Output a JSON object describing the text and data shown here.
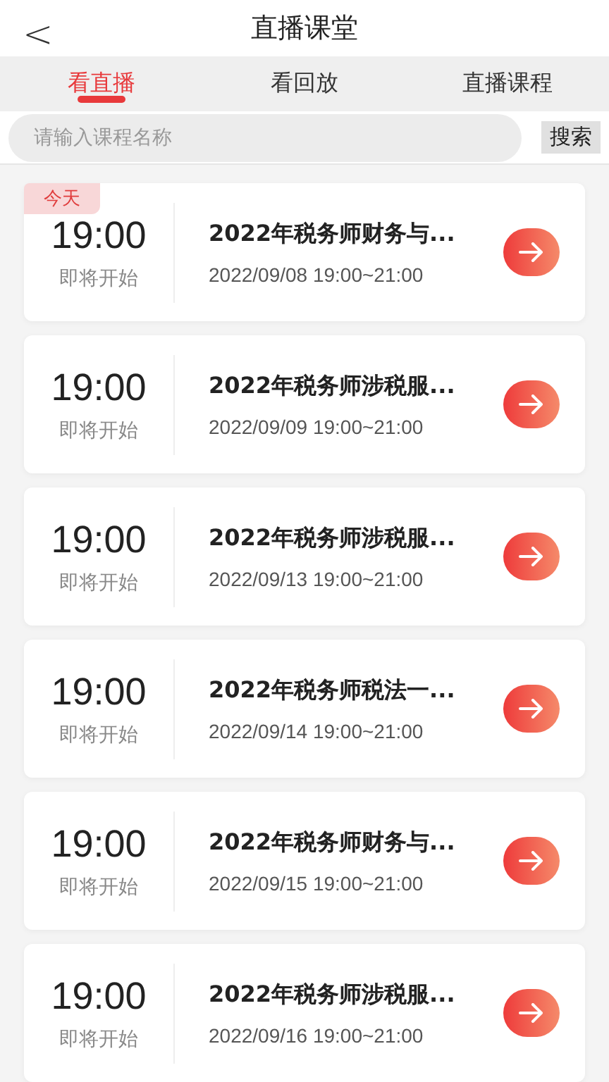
{
  "header": {
    "back": "<",
    "title": "直播课堂"
  },
  "tabs": [
    {
      "label": "看直播",
      "selected": true
    },
    {
      "label": "看回放",
      "selected": false
    },
    {
      "label": "直播课程",
      "selected": false
    }
  ],
  "search": {
    "placeholder": "请输入课程名称",
    "button": "搜索"
  },
  "lessons": [
    {
      "tag": "今天",
      "time": "19:00",
      "status": "即将开始",
      "title": "2022年税务师财务与...",
      "date": "2022/09/08 19:00~21:00"
    },
    {
      "time": "19:00",
      "status": "即将开始",
      "title": "2022年税务师涉税服...",
      "date": "2022/09/09 19:00~21:00"
    },
    {
      "time": "19:00",
      "status": "即将开始",
      "title": "2022年税务师涉税服...",
      "date": "2022/09/13 19:00~21:00"
    },
    {
      "time": "19:00",
      "status": "即将开始",
      "title": "2022年税务师税法一...",
      "date": "2022/09/14 19:00~21:00"
    },
    {
      "time": "19:00",
      "status": "即将开始",
      "title": "2022年税务师财务与...",
      "date": "2022/09/15 19:00~21:00"
    },
    {
      "time": "19:00",
      "status": "即将开始",
      "title": "2022年税务师涉税服...",
      "date": "2022/09/16 19:00~21:00"
    }
  ]
}
